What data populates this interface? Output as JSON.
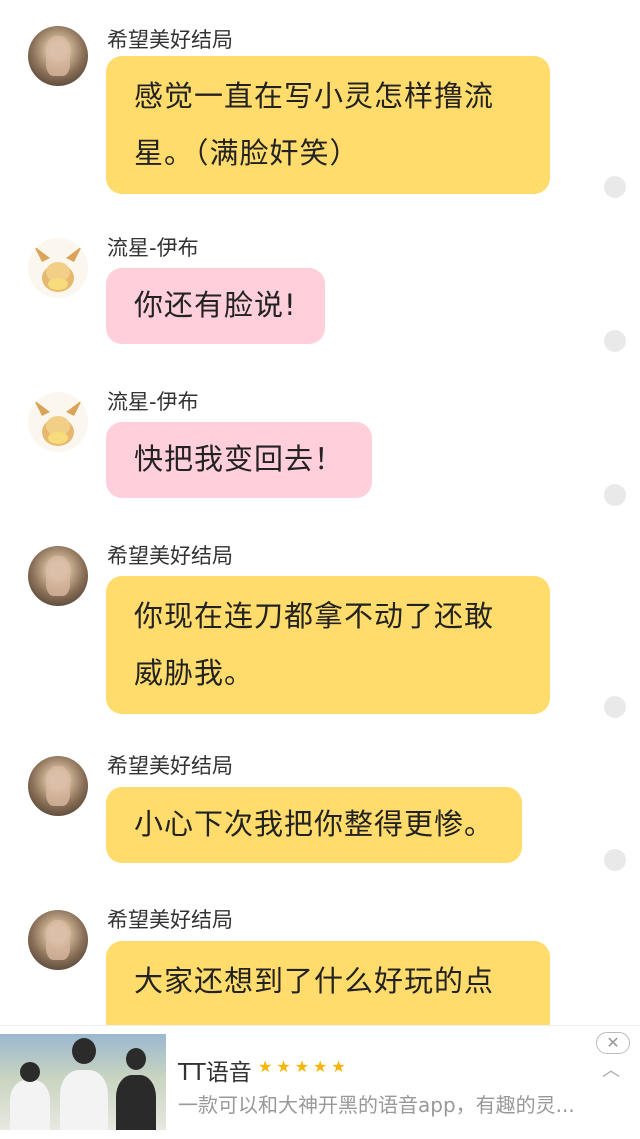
{
  "messages": [
    {
      "sender": "希望美好结局",
      "text": "感觉一直在写小灵怎样撸流星。（满脸奸笑）"
    },
    {
      "sender": "流星-伊布",
      "text": "你还有脸说!"
    },
    {
      "sender": "流星-伊布",
      "text": "快把我变回去！"
    },
    {
      "sender": "希望美好结局",
      "text": "你现在连刀都拿不动了还敢威胁我。"
    },
    {
      "sender": "希望美好结局",
      "text": "小心下次我把你整得更惨。"
    },
    {
      "sender": "希望美好结局",
      "text": "大家还想到了什么好玩的点"
    }
  ],
  "ad": {
    "title": "TT语音",
    "stars": "★★★★★",
    "description": "一款可以和大神开黑的语音app，有趣的灵...",
    "close_icon": "close-icon",
    "collapse_icon": "chevron-up-icon"
  },
  "colors": {
    "yellow_bubble": "#ffdc6b",
    "pink_bubble": "#ffcfdc"
  }
}
